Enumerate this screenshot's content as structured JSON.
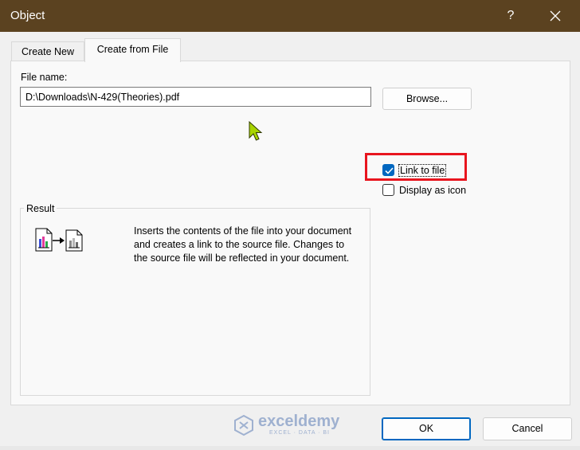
{
  "window": {
    "title": "Object",
    "help_label": "?"
  },
  "tabs": [
    {
      "label": "Create New",
      "active": false
    },
    {
      "label": "Create from File",
      "active": true
    }
  ],
  "file": {
    "label": "File name:",
    "value": "D:\\Downloads\\N-429(Theories).pdf"
  },
  "browse": {
    "label": "Browse..."
  },
  "options": {
    "link_to_file": {
      "label": "Link to file",
      "checked": true
    },
    "display_as_icon": {
      "label": "Display as icon",
      "checked": false
    }
  },
  "result": {
    "legend": "Result",
    "description": "Inserts the contents of the file into your document and creates a link to the source file. Changes to the source file will be reflected in your document."
  },
  "watermark": {
    "brand": "exceldemy",
    "tagline": "EXCEL · DATA · BI"
  },
  "buttons": {
    "ok": "OK",
    "cancel": "Cancel"
  },
  "colors": {
    "titlebar": "#5b4220",
    "accent": "#0067c0",
    "highlight": "#e8151e"
  }
}
